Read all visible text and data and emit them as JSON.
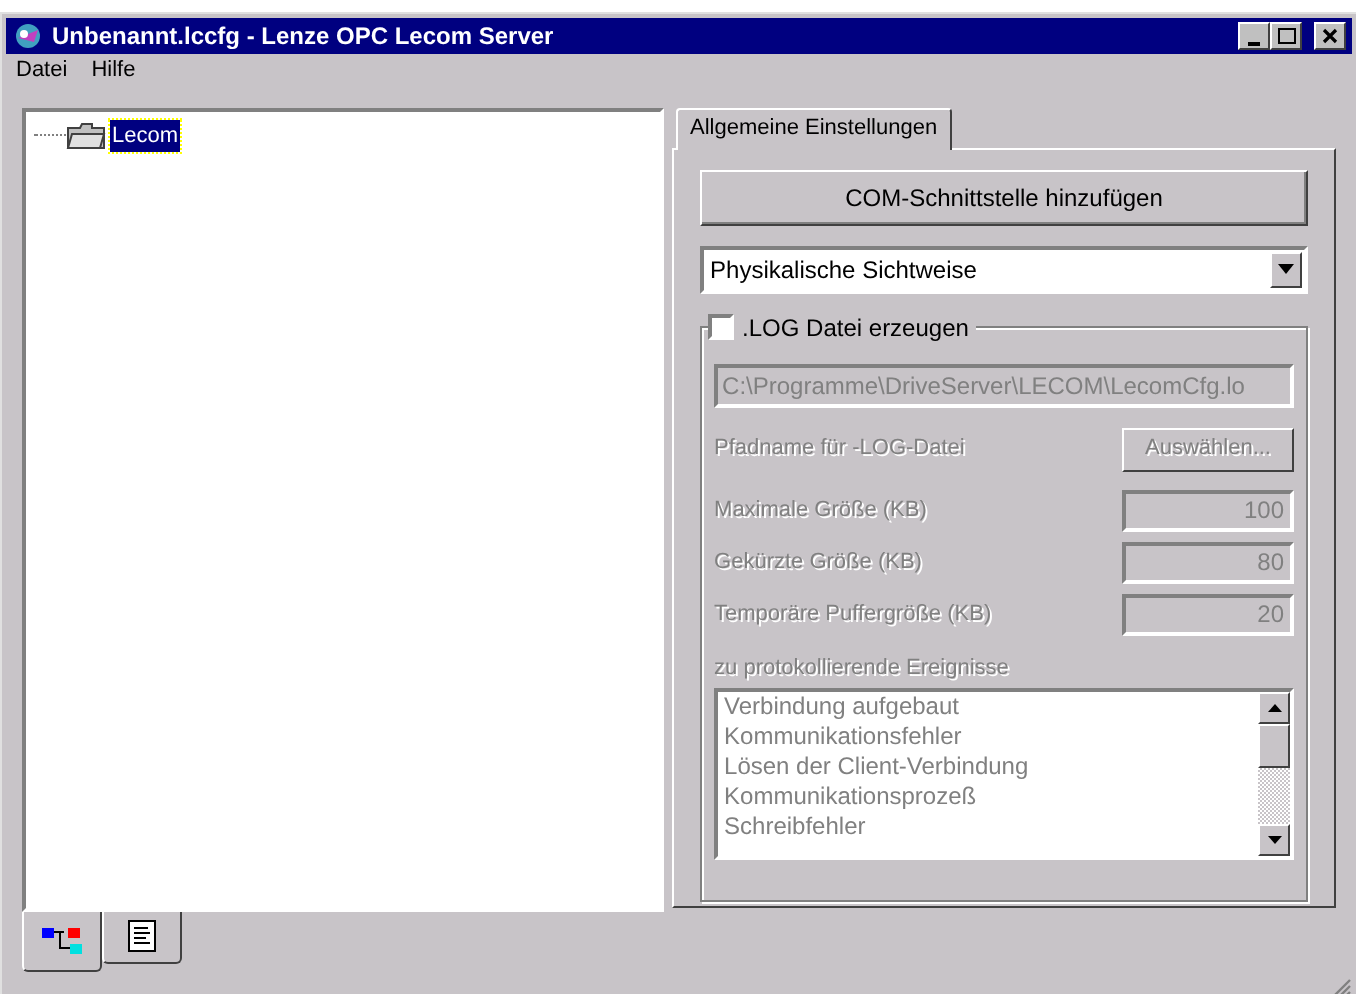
{
  "window": {
    "title": "Unbenannt.lccfg - Lenze OPC Lecom Server"
  },
  "menu": [
    "Datei",
    "Hilfe"
  ],
  "tree": {
    "items": [
      {
        "label": "Lecom",
        "selected": true
      }
    ]
  },
  "bottom_tabs": [
    {
      "kind": "tree",
      "selected": true
    },
    {
      "kind": "document",
      "selected": false
    }
  ],
  "tabs": [
    {
      "label": "Allgemeine Einstellungen"
    }
  ],
  "add_button": "COM-Schnittstelle hinzufügen",
  "view_select": {
    "value": "Physikalische Sichtweise"
  },
  "log": {
    "label": ".LOG Datei erzeugen",
    "checked": false,
    "path": "C:\\Programme\\DriveServer\\LECOM\\LecomCfg.lo",
    "path_label": "Pfadname für -LOG-Datei",
    "browse_button": "Auswählen...",
    "sizes": [
      {
        "label": "Maximale Größe (KB)",
        "value": "100"
      },
      {
        "label": "Gekürzte Größe (KB)",
        "value": "80"
      },
      {
        "label": "Temporäre Puffergröße (KB)",
        "value": "20"
      }
    ],
    "events_label": "zu protokollierende Ereignisse",
    "events": [
      "Verbindung aufgebaut",
      "Kommunikationsfehler",
      "Lösen der Client-Verbindung",
      "Kommunikationsprozeß",
      "Schreibfehler"
    ]
  }
}
